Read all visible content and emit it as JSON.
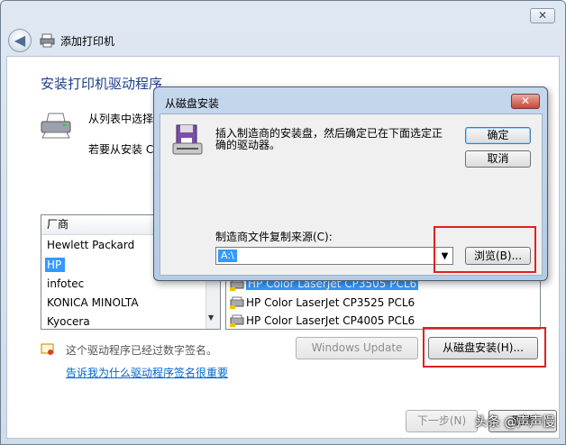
{
  "window": {
    "title": "添加打印机",
    "close_glyph": "✕",
    "back_glyph": "◀"
  },
  "main": {
    "heading": "安装打印机驱动程序",
    "line1": "从列表中选择",
    "line2": "若要从安装 C",
    "manufacturers": {
      "header": "厂商",
      "items": [
        "Hewlett Packard",
        "HP",
        "infotec",
        "KONICA MINOLTA",
        "Kyocera"
      ],
      "selected": "HP"
    },
    "printers": {
      "items": [
        "HP Color LaserJet CP3505 PCL6",
        "HP Color LaserJet CP3525 PCL6",
        "HP Color LaserJet CP4005 PCL6"
      ]
    },
    "signed_text": "这个驱动程序已经过数字签名。",
    "signing_link": "告诉我为什么驱动程序签名很重要",
    "windows_update_button": "Windows Update",
    "have_disk_button": "从磁盘安装(H)...",
    "next_button": "下一步(N)",
    "cancel_button": "取消"
  },
  "dialog": {
    "title": "从磁盘安装",
    "close_glyph": "✕",
    "message_line1": "插入制造商的安装盘，然后确定已在下面选定正",
    "message_line2": "确的驱动器。",
    "ok_button": "确定",
    "cancel_button": "取消",
    "copy_from_label": "制造商文件复制来源(C):",
    "copy_from_value": "A:\\",
    "browse_button": "浏览(B)..."
  },
  "watermark": "头条 @声声慢",
  "colors": {
    "accent": "#1e3f8c",
    "selection": "#3399ff",
    "highlight_box": "#e02020",
    "link": "#0066cc"
  }
}
